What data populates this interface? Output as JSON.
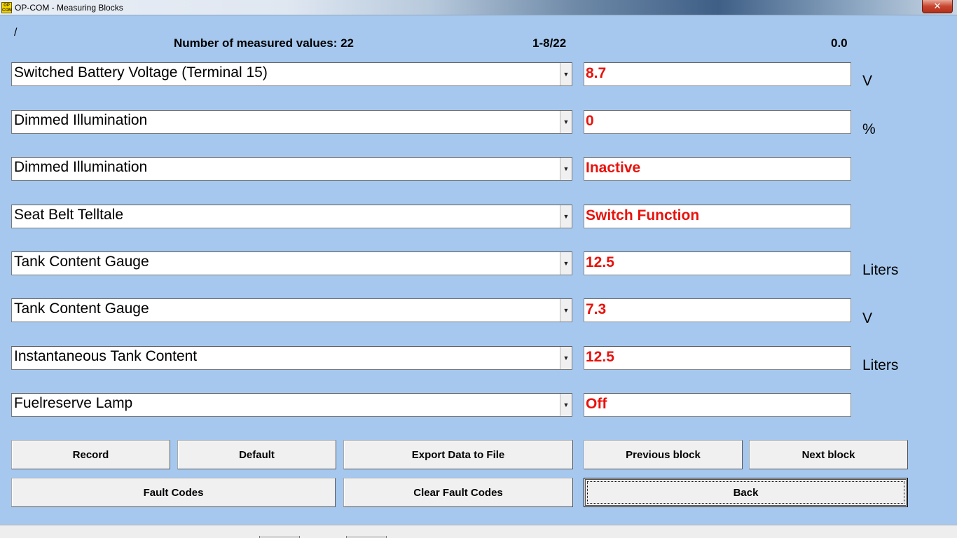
{
  "window": {
    "title": "OP-COM - Measuring Blocks",
    "close_symbol": "✕",
    "icon_text_top": "OP",
    "icon_text_bottom": "COM"
  },
  "header": {
    "marker": "/",
    "count_label": "Number of measured values: 22",
    "range": "1-8/22",
    "time": "0.0"
  },
  "rows": [
    {
      "name": "Switched Battery Voltage (Terminal 15)",
      "value": "8.7",
      "unit": "V"
    },
    {
      "name": "Dimmed Illumination",
      "value": "0",
      "unit": "%"
    },
    {
      "name": "Dimmed Illumination",
      "value": "Inactive",
      "unit": ""
    },
    {
      "name": "Seat Belt Telltale",
      "value": "Switch Function",
      "unit": ""
    },
    {
      "name": "Tank Content Gauge",
      "value": "12.5",
      "unit": "Liters"
    },
    {
      "name": "Tank Content Gauge",
      "value": "7.3",
      "unit": "V"
    },
    {
      "name": "Instantaneous Tank Content",
      "value": "12.5",
      "unit": "Liters"
    },
    {
      "name": "Fuelreserve Lamp",
      "value": "Off",
      "unit": ""
    }
  ],
  "dropdown_arrow": "▼",
  "buttons": {
    "record": "Record",
    "default": "Default",
    "export": "Export Data to File",
    "previous": "Previous block",
    "next": "Next block",
    "fault_codes": "Fault Codes",
    "clear_fault_codes": "Clear Fault Codes",
    "back": "Back"
  },
  "colors": {
    "background": "#a6c8ee",
    "value_text": "#e8120c"
  }
}
